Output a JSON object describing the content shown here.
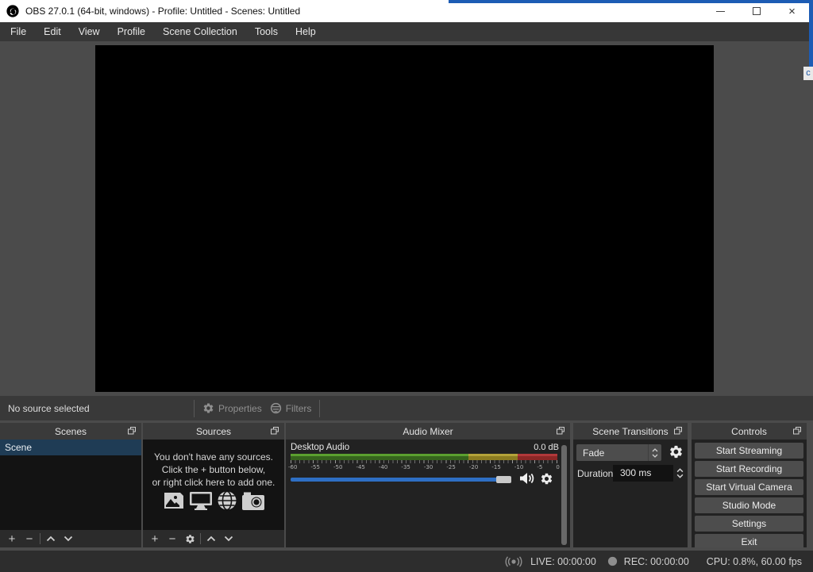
{
  "window": {
    "title": "OBS 27.0.1 (64-bit, windows) - Profile: Untitled - Scenes: Untitled",
    "close_glyph": "×"
  },
  "background_window": {
    "partial_text": "c",
    "accent_color": "#1d5cb4"
  },
  "menu": {
    "items": [
      "File",
      "Edit",
      "View",
      "Profile",
      "Scene Collection",
      "Tools",
      "Help"
    ]
  },
  "source_toolbar": {
    "status": "No source selected",
    "properties_label": "Properties",
    "filters_label": "Filters"
  },
  "panels": {
    "scenes": {
      "title": "Scenes",
      "items": [
        {
          "name": "Scene",
          "selected": true
        }
      ]
    },
    "sources": {
      "title": "Sources",
      "empty_lines": [
        "You don't have any sources.",
        "Click the + button below,",
        "or right click here to add one."
      ]
    },
    "audio_mixer": {
      "title": "Audio Mixer",
      "track": {
        "name": "Desktop Audio",
        "level_db": "0.0 dB",
        "slider_fraction": 1.0,
        "meter": {
          "range_db": [
            -60,
            0
          ],
          "ticks": [
            "-60",
            "-55",
            "-50",
            "-45",
            "-40",
            "-35",
            "-30",
            "-25",
            "-20",
            "-15",
            "-10",
            "-5",
            "0"
          ],
          "segments": [
            {
              "to_db": -20,
              "top_hex": "#5ba02f",
              "body_hex": "#36631d"
            },
            {
              "to_db": -9,
              "top_hex": "#b5a339",
              "body_hex": "#8c7c21"
            },
            {
              "to_db": 0,
              "top_hex": "#b2383a",
              "body_hex": "#8c2726"
            }
          ]
        }
      }
    },
    "scene_transitions": {
      "title": "Scene Transitions",
      "transition": "Fade",
      "duration_label": "Duration",
      "duration_value": "300 ms"
    },
    "controls": {
      "title": "Controls",
      "buttons": [
        "Start Streaming",
        "Start Recording",
        "Start Virtual Camera",
        "Studio Mode",
        "Settings",
        "Exit"
      ]
    }
  },
  "status_bar": {
    "live": "LIVE: 00:00:00",
    "rec": "REC: 00:00:00",
    "cpu": "CPU: 0.8%, 60.00 fps"
  },
  "colors": {
    "selection_blue": "#1f3c55",
    "slider_blue": "#2e6fc4",
    "titlebar_bg": "#ffffff",
    "menubar_bg": "#373737",
    "main_bg": "#4b4b4b"
  }
}
